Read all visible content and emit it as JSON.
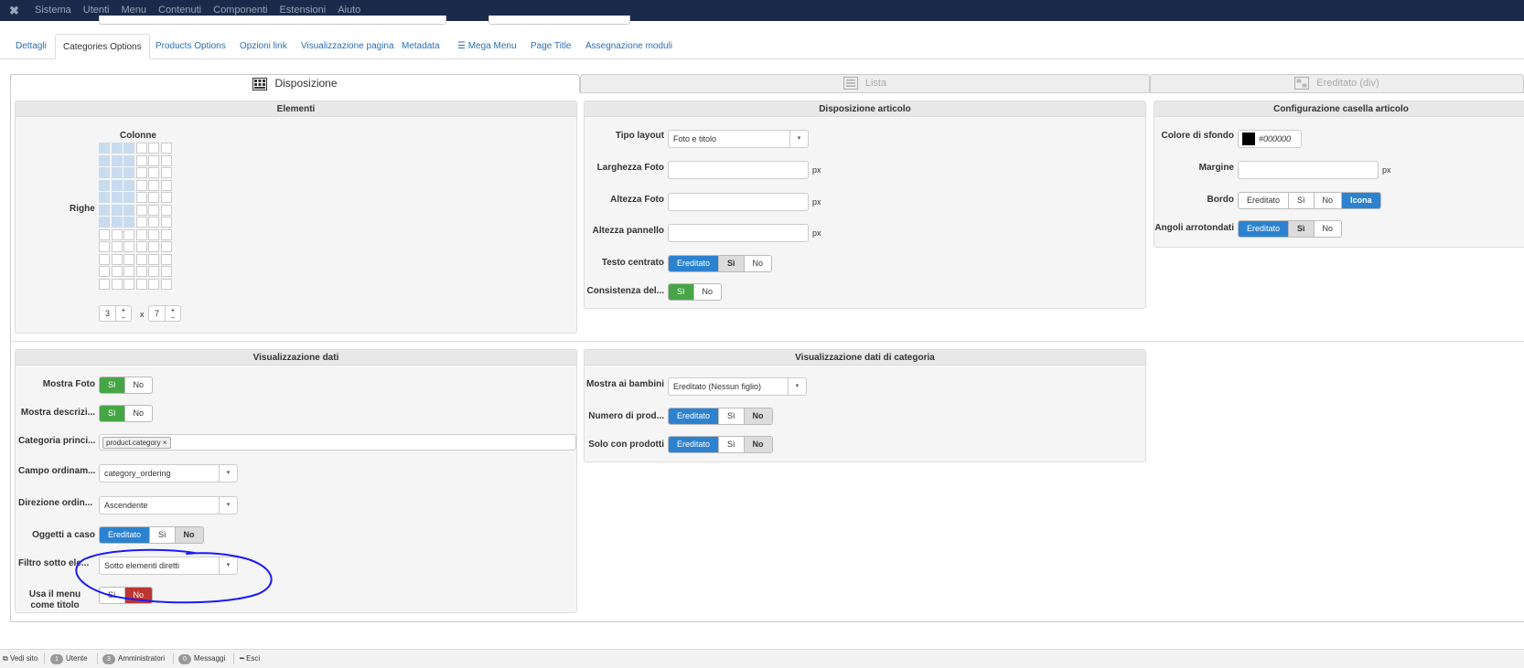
{
  "topbar": {
    "menu": [
      "Sistema",
      "Utenti",
      "Menu",
      "Contenuti",
      "Componenti",
      "Estensioni",
      "Aiuto"
    ]
  },
  "tabs": [
    "Dettagli",
    "Categories Options",
    "Products Options",
    "Opzioni link",
    "Visualizzazione pagina",
    "Metadata",
    "Mega Menu",
    "Page Title",
    "Assegnazione moduli"
  ],
  "subtabs": {
    "disposizione": "Disposizione",
    "lista": "Lista",
    "ereditato": "Ereditato (div)"
  },
  "elementi": {
    "title": "Elementi",
    "colonne": "Colonne",
    "righe": "Righe",
    "cols_value": "3",
    "rows_value": "7",
    "times": "x",
    "plusminus": "+",
    "minus": "–",
    "selected_cols": 3,
    "selected_rows": 7
  },
  "disposizione_articolo": {
    "title": "Disposizione articolo",
    "tipo_layout_label": "Tipo layout",
    "tipo_layout_value": "Foto e titolo",
    "larghezza_label": "Larghezza Foto",
    "altezza_label": "Altezza Foto",
    "pannello_label": "Altezza pannello",
    "unit": "px",
    "testo_centrato_label": "Testo centrato",
    "consistenza_label": "Consistenza del...",
    "btn_ereditato": "Ereditato",
    "btn_si": "Sì",
    "btn_no": "No"
  },
  "configurazione": {
    "title": "Configurazione casella articolo",
    "colore_label": "Colore di sfondo",
    "colore_value": "#000000",
    "margine_label": "Margine",
    "unit": "px",
    "bordo_label": "Bordo",
    "angoli_label": "Angoli arrotondati",
    "btn_ereditato": "Ereditato",
    "btn_si": "Sì",
    "btn_no": "No",
    "btn_icona": "Icona"
  },
  "visualizzazione_dati": {
    "title": "Visualizzazione dati",
    "mostra_foto_label": "Mostra Foto",
    "mostra_descr_label": "Mostra descrizi...",
    "categoria_label": "Categoria princi...",
    "categoria_tag": "product.category",
    "campo_label": "Campo ordinam...",
    "campo_value": "category_ordering",
    "direzione_label": "Direzione ordin...",
    "direzione_value": "Ascendente",
    "oggetti_label": "Oggetti a caso",
    "filtro_label": "Filtro sotto ele...",
    "filtro_value": "Sotto elementi diretti",
    "usa_menu_label_1": "Usa il menu",
    "usa_menu_label_2": "come titolo",
    "btn_ereditato": "Ereditato",
    "btn_si": "Sì",
    "btn_no": "No"
  },
  "categoria_dati": {
    "title": "Visualizzazione dati di categoria",
    "mostra_bambini_label": "Mostra ai bambini",
    "mostra_bambini_value": "Ereditato (Nessun figlio)",
    "numero_label": "Numero di prod...",
    "solo_label": "Solo con prodotti",
    "btn_ereditato": "Ereditato",
    "btn_si": "Sì",
    "btn_no": "No"
  },
  "statusbar": {
    "vedi_sito": "Vedi sito",
    "utente_count": "1",
    "utente": "Utente",
    "admin_count": "3",
    "admin": "Amministratori",
    "msg_count": "0",
    "messaggi": "Messaggi",
    "esci": "Esci"
  },
  "colors": {
    "topbar": "#1b2a4a",
    "blue_active": "#2d82d0",
    "green_active": "#46a546",
    "red_active": "#bd362f",
    "annotation": "#1a1aff"
  }
}
